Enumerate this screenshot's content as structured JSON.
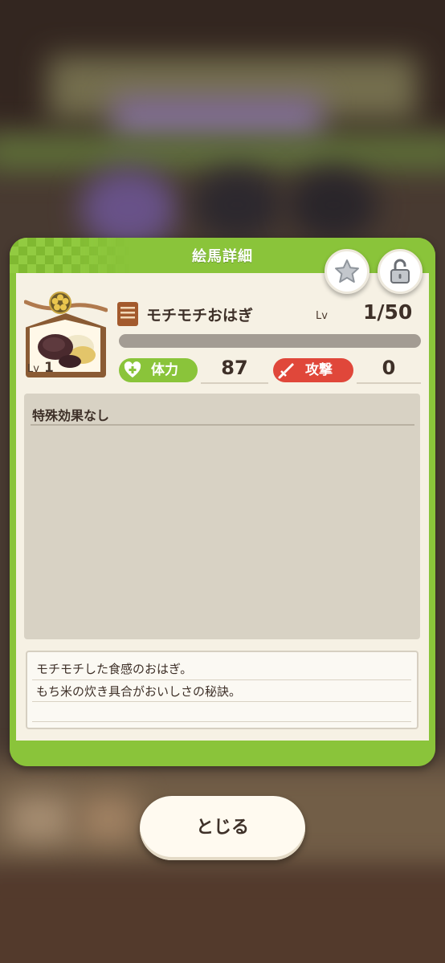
{
  "dialog": {
    "title": "絵馬詳細"
  },
  "buttons": {
    "favorite_icon": "star-icon",
    "lock_icon": "unlock-icon",
    "close_label": "とじる"
  },
  "ema": {
    "lv_label": "Lv",
    "level": "1"
  },
  "item": {
    "name": "モチモチおはぎ",
    "lv_label": "Lv",
    "level_progress": "1/50",
    "xp_fraction": 0.0
  },
  "stats": {
    "hp_label": "体力",
    "hp_value": "87",
    "atk_label": "攻撃",
    "atk_value": "0"
  },
  "effect": {
    "title": "特殊効果なし"
  },
  "description": {
    "line1": "モチモチした食感のおはぎ。",
    "line2": "もち米の炊き具合がおいしさの秘訣。"
  },
  "colors": {
    "accent_green": "#8ac43a",
    "attack_red": "#e0473a",
    "panel_bg": "#f6f1e4"
  }
}
